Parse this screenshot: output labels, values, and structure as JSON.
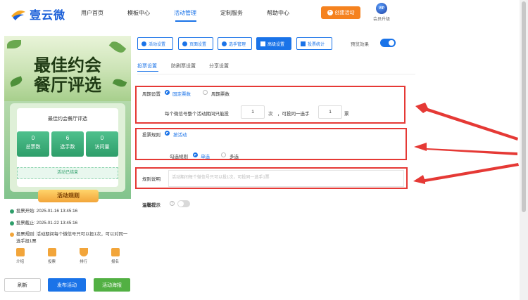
{
  "header": {
    "logo_text": "壹云微",
    "nav": [
      "用户首页",
      "模板中心",
      "活动管理",
      "定制服务",
      "帮助中心"
    ],
    "active_nav": "活动管理",
    "create_button": "创建活动",
    "vip_badge": "VIP",
    "vip_label": "会员升级"
  },
  "phone_preview": {
    "banner_line1": "最佳约会",
    "banner_line2": "餐厅评选",
    "card_title": "最佳约会餐厅评选",
    "stats": [
      {
        "value": "0",
        "label": "总票数"
      },
      {
        "value": "6",
        "label": "选手数"
      },
      {
        "value": "0",
        "label": "访问量"
      }
    ],
    "status": "活动已结束",
    "rules_title": "活动规则",
    "rules": [
      {
        "text": "投票开始: 2025-01-16 13:45:16",
        "color": "#2e9e6a"
      },
      {
        "text": "投票截止: 2025-01-22 13:45:16",
        "color": "#2e9e6a"
      },
      {
        "text": "投票规则: 活动期间每个微信号只可以投1次，可以对同一选手投1票",
        "color": "#f2a53a"
      }
    ],
    "tabs": [
      {
        "label": "介绍",
        "color": "#f2a53a"
      },
      {
        "label": "投票",
        "color": "#f2a53a"
      },
      {
        "label": "排行",
        "color": "#f2a53a"
      },
      {
        "label": "报名",
        "color": "#f2a53a"
      }
    ]
  },
  "bottom_buttons": {
    "refresh": "刷新",
    "publish": "发布活动",
    "poster": "活动海报"
  },
  "toolbar": {
    "items": [
      "活动设置",
      "页面设置",
      "选手管理",
      "高级设置",
      "投票统计"
    ],
    "active": "高级设置",
    "preview_label": "预览效果",
    "preview_on": true
  },
  "subtabs": {
    "items": [
      "投票设置",
      "防刷票设置",
      "分享设置"
    ],
    "active": "投票设置"
  },
  "form": {
    "cycle_label": "周期设置",
    "cycle_options": [
      "固定票数",
      "周期票数"
    ],
    "cycle_selected": "固定票数",
    "limit_prefix": "每个微信号整个活动期间只能投",
    "limit_value": "1",
    "limit_unit": "次",
    "same_prefix": "，可投同一选手",
    "same_value": "1",
    "same_unit": "票",
    "rule_label": "投票规则",
    "rule_option": "按活动",
    "check_label": "勾选规则",
    "check_options": [
      "单选",
      "多选"
    ],
    "check_selected": "单选",
    "desc_label": "规则说明",
    "desc_placeholder": "活动期间每个微信号只可以投1次，可投同一选手1票",
    "warn_label": "温馨提示",
    "warn_on": false
  },
  "colors": {
    "primary": "#1a73e8",
    "highlight": "#e53935",
    "create": "#f5821f"
  }
}
